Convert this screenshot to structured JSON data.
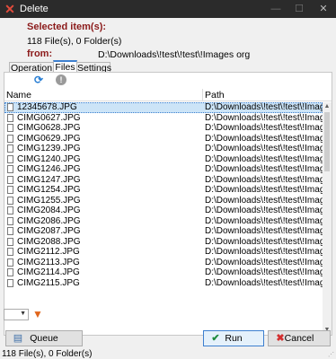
{
  "window": {
    "title": "Delete",
    "minimize_glyph": "—",
    "maximize_glyph": "☐",
    "close_glyph": "✕"
  },
  "header": {
    "selected_label": "Selected item(s):",
    "selected_count": "118 File(s), 0 Folder(s)",
    "from_label": "from:",
    "from_path": "D:\\Downloads\\!test\\!test\\!Images org"
  },
  "tabs": [
    {
      "label": "Operation",
      "active": false
    },
    {
      "label": "Files",
      "active": true
    },
    {
      "label": "Settings",
      "active": false
    }
  ],
  "table": {
    "columns": [
      "Name",
      "Path"
    ],
    "rows": [
      {
        "name": "12345678.JPG",
        "path": "D:\\Downloads\\!test\\!test\\!Images org"
      },
      {
        "name": "CIMG0627.JPG",
        "path": "D:\\Downloads\\!test\\!test\\!Images org"
      },
      {
        "name": "CIMG0628.JPG",
        "path": "D:\\Downloads\\!test\\!test\\!Images org"
      },
      {
        "name": "CIMG0629.JPG",
        "path": "D:\\Downloads\\!test\\!test\\!Images org"
      },
      {
        "name": "CIMG1239.JPG",
        "path": "D:\\Downloads\\!test\\!test\\!Images org"
      },
      {
        "name": "CIMG1240.JPG",
        "path": "D:\\Downloads\\!test\\!test\\!Images org"
      },
      {
        "name": "CIMG1246.JPG",
        "path": "D:\\Downloads\\!test\\!test\\!Images org"
      },
      {
        "name": "CIMG1247.JPG",
        "path": "D:\\Downloads\\!test\\!test\\!Images org"
      },
      {
        "name": "CIMG1254.JPG",
        "path": "D:\\Downloads\\!test\\!test\\!Images org"
      },
      {
        "name": "CIMG1255.JPG",
        "path": "D:\\Downloads\\!test\\!test\\!Images org"
      },
      {
        "name": "CIMG2084.JPG",
        "path": "D:\\Downloads\\!test\\!test\\!Images org"
      },
      {
        "name": "CIMG2086.JPG",
        "path": "D:\\Downloads\\!test\\!test\\!Images org"
      },
      {
        "name": "CIMG2087.JPG",
        "path": "D:\\Downloads\\!test\\!test\\!Images org"
      },
      {
        "name": "CIMG2088.JPG",
        "path": "D:\\Downloads\\!test\\!test\\!Images org"
      },
      {
        "name": "CIMG2112.JPG",
        "path": "D:\\Downloads\\!test\\!test\\!Images org"
      },
      {
        "name": "CIMG2113.JPG",
        "path": "D:\\Downloads\\!test\\!test\\!Images org"
      },
      {
        "name": "CIMG2114.JPG",
        "path": "D:\\Downloads\\!test\\!test\\!Images org"
      },
      {
        "name": "CIMG2115.JPG",
        "path": "D:\\Downloads\\!test\\!test\\!Images org"
      }
    ],
    "selected_index": 0
  },
  "buttons": {
    "queue": "Queue",
    "run": "Run",
    "cancel": "Cancel"
  },
  "status": {
    "text": "118 File(s), 0 Folder(s)"
  },
  "icons": {
    "app": "delete-x-icon",
    "refresh": "refresh-icon",
    "info": "info-icon",
    "filter": "funnel-icon",
    "queue": "queue-icon",
    "run": "checkmark-icon",
    "cancel": "cancel-x-icon"
  },
  "colors": {
    "label_red": "#8b1a1a",
    "accent_blue": "#3d7fcf",
    "selection": "#cce4f7",
    "run_green": "#1f8c3f",
    "cancel_red": "#d32f2f",
    "filter_orange": "#e0661c"
  }
}
